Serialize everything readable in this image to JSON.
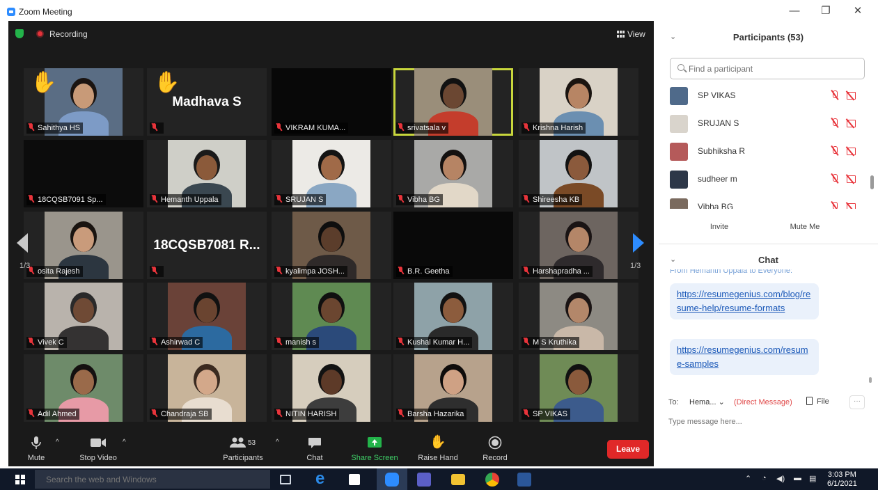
{
  "window": {
    "title": "Zoom Meeting",
    "controls": {
      "minimize": "—",
      "restore": "❐",
      "close": "✕"
    }
  },
  "meeting": {
    "recording_label": "Recording",
    "view_label": "View",
    "page_left": "1/3",
    "page_right": "1/3",
    "tiles": [
      {
        "name": "Sahithya HS",
        "hand_raised": true,
        "bg": "#5a6d84",
        "skin": "#c89a78",
        "shirt": "#7d9bc6",
        "hair": "#1b1411"
      },
      {
        "name": "",
        "display_name": "Madhava S",
        "hand_raised": true,
        "bg": "#232323"
      },
      {
        "name": "VIKRAM KUMA...",
        "bg": "#080808"
      },
      {
        "name": "srivatsala v",
        "speaking": true,
        "bg": "#9a8e7a",
        "skin": "#6b4732",
        "shirt": "#c43d2c",
        "hair": "#111"
      },
      {
        "name": "Krishna Harish",
        "bg": "#d9d2c6",
        "skin": "#b78564",
        "shirt": "#6b8fb1",
        "hair": "#1a1410"
      },
      {
        "name": "18CQSB7091 Sp...",
        "bg": "#0c0c0c"
      },
      {
        "name": "Hemanth Uppala",
        "bg": "#cfcfc8",
        "skin": "#8b5a3a",
        "shirt": "#3a4750",
        "hair": "#1a1a1a"
      },
      {
        "name": "SRUJAN S",
        "bg": "#eceae6",
        "skin": "#a06a48",
        "shirt": "#8aa7c3",
        "hair": "#141414"
      },
      {
        "name": "Vibha BG",
        "bg": "#a9a9a7",
        "skin": "#b68464",
        "shirt": "#e2d8c8",
        "hair": "#141110"
      },
      {
        "name": "Shireesha KB",
        "bg": "#c0c4c7",
        "skin": "#8b5a3c",
        "shirt": "#7a4a26",
        "hair": "#121212"
      },
      {
        "name": "osita Rajesh",
        "bg": "#9a958c",
        "skin": "#c99b7b",
        "shirt": "#2c3640",
        "hair": "#1a1410"
      },
      {
        "name": "",
        "display_name": "18CQSB7081 R...",
        "bg": "#232323"
      },
      {
        "name": "kyalimpa JOSH...",
        "bg": "#6e5a48",
        "skin": "#5b3d2b",
        "shirt": "#2f2a29",
        "hair": "#0e0e0e"
      },
      {
        "name": "B.R. Geetha",
        "bg": "#090909"
      },
      {
        "name": "Harshapradha ...",
        "bg": "#6d6560",
        "skin": "#b48668",
        "shirt": "#2e2a2c",
        "hair": "#1a1414"
      },
      {
        "name": "Vivek C",
        "bg": "#b9b3ac",
        "skin": "#6f4a35",
        "shirt": "#343232",
        "hair": "#2a2a2a"
      },
      {
        "name": "Ashirwad C",
        "bg": "#6a4238",
        "skin": "#6a4430",
        "shirt": "#2c6aa0",
        "hair": "#111"
      },
      {
        "name": "manish s",
        "bg": "#5f8a52",
        "skin": "#6b4630",
        "shirt": "#2b4a7a",
        "hair": "#101010"
      },
      {
        "name": "Kushal Kumar H...",
        "bg": "#8ea2a8",
        "skin": "#8c5c3d",
        "shirt": "#2a2a2a",
        "hair": "#121212"
      },
      {
        "name": "M S Kruthika",
        "bg": "#8d8a83",
        "skin": "#b3876a",
        "shirt": "#c9b8a8",
        "hair": "#1a1414"
      },
      {
        "name": "Adil Ahmed",
        "bg": "#6e8b6a",
        "skin": "#9a6a4a",
        "shirt": "#e79aa6",
        "hair": "#141010"
      },
      {
        "name": "Chandraja SB",
        "bg": "#c8b49a",
        "skin": "#d3a88a",
        "shirt": "#e8ddd0",
        "hair": "#3a2a20"
      },
      {
        "name": "NITIN HARISH",
        "bg": "#d6cdbd",
        "skin": "#5d3a28",
        "shirt": "#3d3d3d",
        "hair": "#121212"
      },
      {
        "name": "Barsha Hazarika",
        "bg": "#b7a28c",
        "skin": "#cfa184",
        "shirt": "#2e2e2e",
        "hair": "#0f0c0b"
      },
      {
        "name": "SP VIKAS",
        "bg": "#6f8b56",
        "skin": "#8a5a3c",
        "shirt": "#3c5b8c",
        "hair": "#111"
      }
    ]
  },
  "toolbar": {
    "mute": "Mute",
    "stop_video": "Stop Video",
    "participants": "Participants",
    "participants_count": "53",
    "chat": "Chat",
    "share_screen": "Share Screen",
    "raise_hand": "Raise Hand",
    "record": "Record",
    "leave": "Leave",
    "caret": "^"
  },
  "participants_panel": {
    "title": "Participants (53)",
    "search_placeholder": "Find a participant",
    "rows": [
      {
        "name": "SP VIKAS",
        "avatar": "#4f6a8a"
      },
      {
        "name": "SRUJAN S",
        "avatar": "#d9d4cc"
      },
      {
        "name": "Subhiksha R",
        "avatar": "#b55a5a"
      },
      {
        "name": "sudheer m",
        "avatar": "#2d3748"
      },
      {
        "name": "Vibha BG",
        "avatar": "#7a6a5e"
      }
    ],
    "invite": "Invite",
    "mute_me": "Mute Me"
  },
  "chat_panel": {
    "title": "Chat",
    "from_line": "From Hemanth Uppala to Everyone:",
    "messages": [
      "https://resumegenius.com/blog/resume-help/resume-formats",
      "https://resumegenius.com/resume-samples"
    ],
    "to_label": "To:",
    "to_value": "Hema...",
    "direct_message": "(Direct Message)",
    "file_label": "File",
    "more_label": "···",
    "input_placeholder": "Type message here..."
  },
  "taskbar": {
    "search_placeholder": "Search the web and Windows",
    "time": "3:03 PM",
    "date": "6/1/2021"
  },
  "colors": {
    "meeting_bg": "#1a1a1a",
    "speaking_border": "#c8d63c",
    "leave_red": "#e02828",
    "zoom_blue": "#2d8cff",
    "share_green": "#23b34a"
  }
}
